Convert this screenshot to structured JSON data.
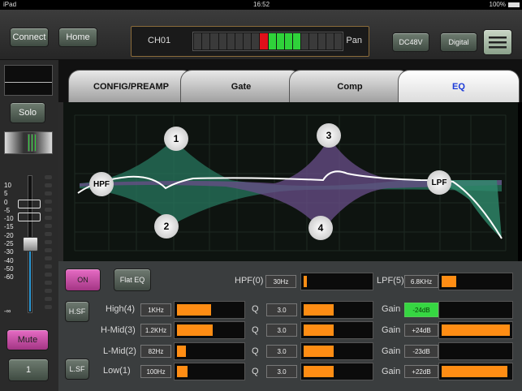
{
  "status": {
    "device": "iPad",
    "time": "16:52",
    "battery": "100%"
  },
  "top": {
    "connect": "Connect",
    "home": "Home",
    "channel": "CH01",
    "pan": "Pan",
    "dc48v": "DC48V",
    "digital": "Digital"
  },
  "left": {
    "solo": "Solo",
    "mute": "Mute",
    "channel_number": "1",
    "scale": [
      "10",
      "5",
      "0",
      "-5",
      "-10",
      "-15",
      "-20",
      "-25",
      "-30",
      "-40",
      "-50",
      "-60"
    ],
    "minus_inf": "-∞"
  },
  "tabs": [
    {
      "label": "CONFIG/PREAMP",
      "active": false
    },
    {
      "label": "Gate",
      "active": false
    },
    {
      "label": "Comp",
      "active": false
    },
    {
      "label": "EQ",
      "active": true
    }
  ],
  "eq_nodes": {
    "hpf": "HPF",
    "lpf": "LPF",
    "n1": "1",
    "n2": "2",
    "n3": "3",
    "n4": "4"
  },
  "controls": {
    "on": "ON",
    "flat_eq": "Flat EQ",
    "hsf": "H.SF",
    "lsf": "L.SF",
    "hpf_label": "HPF(0)",
    "hpf_value": "30Hz",
    "hpf_level": 0.05,
    "lpf_label": "LPF(5)",
    "lpf_value": "6.8KHz",
    "lpf_level": 0.22,
    "q_label": "Q",
    "gain_label": "Gain",
    "bands": [
      {
        "name": "High(4)",
        "freq": "1KHz",
        "freq_level": 0.52,
        "q": "3.0",
        "q_level": 0.45,
        "gain": "-24dB",
        "gain_level": 0.0,
        "gain_active": true
      },
      {
        "name": "H-Mid(3)",
        "freq": "1.2KHz",
        "freq_level": 0.55,
        "q": "3.0",
        "q_level": 0.45,
        "gain": "+24dB",
        "gain_level": 1.0,
        "gain_active": false
      },
      {
        "name": "L-Mid(2)",
        "freq": "82Hz",
        "freq_level": 0.14,
        "q": "3.0",
        "q_level": 0.45,
        "gain": "-23dB",
        "gain_level": 0.0,
        "gain_active": false
      },
      {
        "name": "Low(1)",
        "freq": "100Hz",
        "freq_level": 0.16,
        "q": "3.0",
        "q_level": 0.45,
        "gain": "+22dB",
        "gain_level": 0.96,
        "gain_active": false
      }
    ]
  },
  "colors": {
    "accent": "#ff8d14",
    "meter_green": "#2fd23a",
    "meter_red": "#e0101a",
    "active_tab": "#1b3ad8"
  }
}
